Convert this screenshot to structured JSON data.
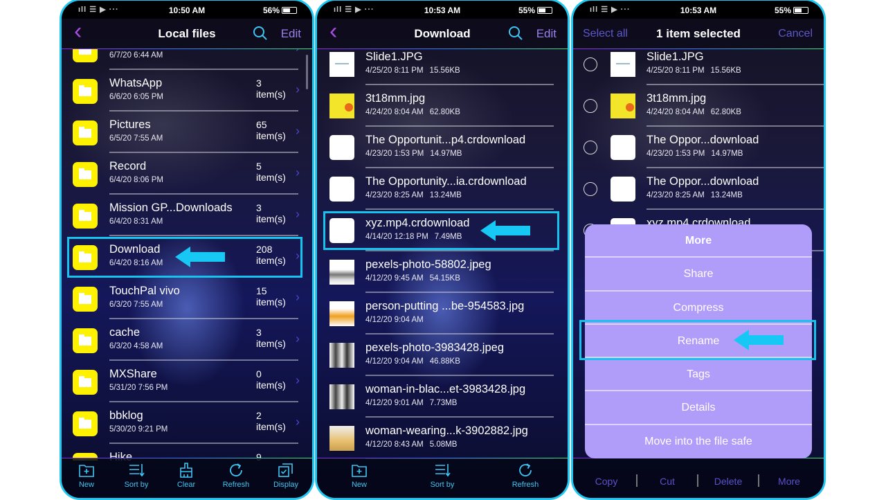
{
  "colors": {
    "accent_cyan": "#1ec8f0",
    "folder_yellow": "#fff200",
    "menu_purple": "#b09cf9",
    "link_purple": "#5d58cc"
  },
  "panels": [
    {
      "status": {
        "signal": "ıll ☰ ▶ ···",
        "time": "10:50 AM",
        "battery": "56%",
        "battery_level": 0.56
      },
      "header": {
        "title": "Local files",
        "back_icon": "chevron-left-icon",
        "search_icon": "search-icon",
        "edit": "Edit"
      },
      "rows": [
        {
          "name": "",
          "date": "6/7/20 6:44 AM",
          "count_num": "",
          "count_unit": "item(s)"
        },
        {
          "name": "WhatsApp",
          "date": "6/6/20 6:05 PM",
          "count_num": "3",
          "count_unit": "item(s)"
        },
        {
          "name": "Pictures",
          "date": "6/5/20 7:55 AM",
          "count_num": "65",
          "count_unit": "item(s)"
        },
        {
          "name": "Record",
          "date": "6/4/20 8:06 PM",
          "count_num": "5",
          "count_unit": "item(s)"
        },
        {
          "name": "Mission GP...Downloads",
          "date": "6/4/20 8:31 AM",
          "count_num": "3",
          "count_unit": "item(s)"
        },
        {
          "name": "Download",
          "date": "6/4/20 8:16 AM",
          "count_num": "208",
          "count_unit": "item(s)"
        },
        {
          "name": "TouchPal vivo",
          "date": "6/3/20 7:55 AM",
          "count_num": "15",
          "count_unit": "item(s)"
        },
        {
          "name": "cache",
          "date": "6/3/20 4:58 AM",
          "count_num": "3",
          "count_unit": "item(s)"
        },
        {
          "name": "MXShare",
          "date": "5/31/20 7:56 PM",
          "count_num": "0",
          "count_unit": "item(s)"
        },
        {
          "name": "bbklog",
          "date": "5/30/20 9:21 PM",
          "count_num": "2",
          "count_unit": "item(s)"
        },
        {
          "name": "Hike",
          "date": "",
          "count_num": "9",
          "count_unit": ""
        }
      ],
      "toolbar": [
        {
          "label": "New",
          "icon": "new-folder-icon"
        },
        {
          "label": "Sort by",
          "icon": "sort-icon"
        },
        {
          "label": "Clear",
          "icon": "brush-icon"
        },
        {
          "label": "Refresh",
          "icon": "refresh-icon"
        },
        {
          "label": "Display",
          "icon": "display-icon"
        }
      ]
    },
    {
      "status": {
        "signal": "ıll ☰ ▶ ···",
        "time": "10:53 AM",
        "battery": "55%",
        "battery_level": 0.55
      },
      "header": {
        "title": "Download",
        "back_icon": "chevron-left-icon",
        "search_icon": "search-icon",
        "edit": "Edit"
      },
      "rows": [
        {
          "name": "Slide1.JPG",
          "date": "4/25/20 8:11 PM",
          "size": "15.56KB",
          "thumb": "white"
        },
        {
          "name": "3t18mm.jpg",
          "date": "4/24/20 8:04 AM",
          "size": "62.80KB",
          "thumb": "yellow"
        },
        {
          "name": "The Opportunit...p4.crdownload",
          "date": "4/23/20 1:53 PM",
          "size": "14.97MB",
          "thumb": "blank"
        },
        {
          "name": "The Opportunity...ia.crdownload",
          "date": "4/23/20 8:25 AM",
          "size": "13.24MB",
          "thumb": "blank"
        },
        {
          "name": "xyz.mp4.crdownload",
          "date": "4/14/20 12:18 PM",
          "size": "7.49MB",
          "thumb": "blank"
        },
        {
          "name": "pexels-photo-58802.jpeg",
          "date": "4/12/20 9:45 AM",
          "size": "54.15KB",
          "thumb": "city"
        },
        {
          "name": "person-putting ...be-954583.jpg",
          "date": "4/12/20 9:04 AM",
          "size": "",
          "thumb": "kid"
        },
        {
          "name": "pexels-photo-3983428.jpeg",
          "date": "4/12/20 9:04 AM",
          "size": "46.88KB",
          "thumb": "people"
        },
        {
          "name": "woman-in-blac...et-3983428.jpg",
          "date": "4/12/20 9:01 AM",
          "size": "7.73MB",
          "thumb": "people"
        },
        {
          "name": "woman-wearing...k-3902882.jpg",
          "date": "4/12/20 8:43 AM",
          "size": "5.08MB",
          "thumb": "woman"
        }
      ],
      "toolbar": [
        {
          "label": "New",
          "icon": "new-folder-icon"
        },
        {
          "label": "Sort by",
          "icon": "sort-icon"
        },
        {
          "label": "Refresh",
          "icon": "refresh-icon"
        }
      ]
    },
    {
      "status": {
        "signal": "ıll ☰ ▶ ···",
        "time": "10:53 AM",
        "battery": "55%",
        "battery_level": 0.55
      },
      "header": {
        "select_all": "Select all",
        "title": "1 item selected",
        "cancel": "Cancel"
      },
      "rows": [
        {
          "name": "Slide1.JPG",
          "date": "4/25/20 8:11 PM",
          "size": "15.56KB",
          "thumb": "white"
        },
        {
          "name": "3t18mm.jpg",
          "date": "4/24/20 8:04 AM",
          "size": "62.80KB",
          "thumb": "yellow"
        },
        {
          "name": "The Oppor...download",
          "date": "4/23/20 1:53 PM",
          "size": "14.97MB",
          "thumb": "blank"
        },
        {
          "name": "The Oppor...download",
          "date": "4/23/20 8:25 AM",
          "size": "13.24MB",
          "thumb": "blank"
        },
        {
          "name": "xyz.mp4.crdownload",
          "date": "",
          "size": "",
          "thumb": "blank"
        }
      ],
      "menu": {
        "title": "More",
        "items": [
          "Share",
          "Compress",
          "Rename",
          "Tags",
          "Details",
          "Move into the file safe"
        ]
      },
      "actions": [
        "Copy",
        "Cut",
        "Delete",
        "More"
      ]
    }
  ]
}
